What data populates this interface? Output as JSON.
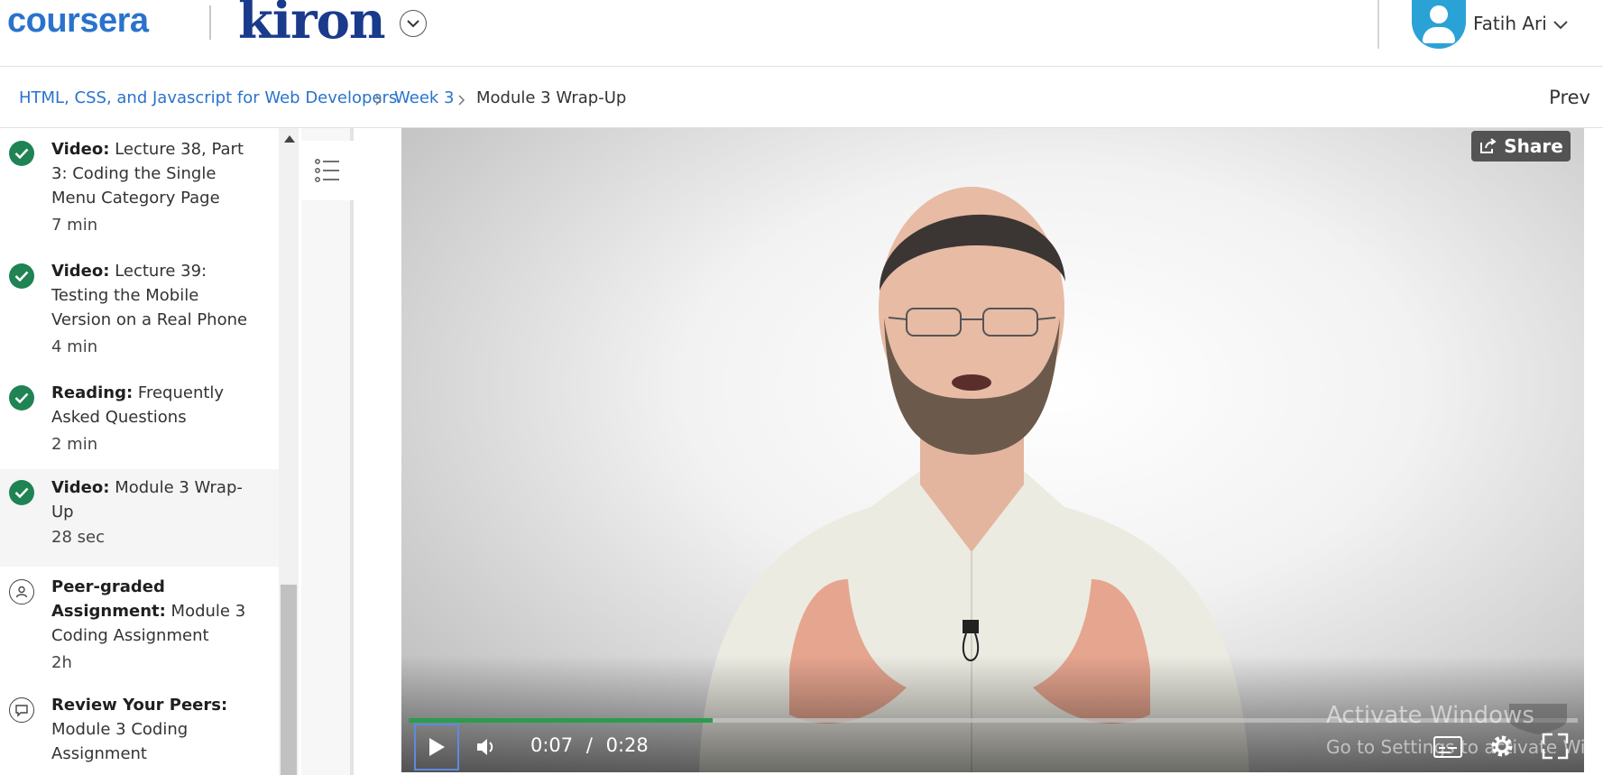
{
  "header": {
    "logo_text": "coursera",
    "partner_text": "kiron",
    "user_name": "Fatih Ari"
  },
  "breadcrumb": {
    "items": [
      "HTML, CSS, and Javascript for Web Developers",
      "Week 3",
      "Module 3 Wrap-Up"
    ],
    "prev_label": "Prev"
  },
  "sidebar": {
    "items": [
      {
        "type": "Video:",
        "title": "Lecture 38, Part 3: Coding the Single Menu Category Page",
        "duration": "7 min",
        "completed": true
      },
      {
        "type": "Video:",
        "title": "Lecture 39: Testing the Mobile Version on a Real Phone",
        "duration": "4 min",
        "completed": true
      },
      {
        "type": "Reading:",
        "title": "Frequently Asked Questions",
        "duration": "2 min",
        "completed": true
      },
      {
        "type": "Video:",
        "title": "Module 3 Wrap-Up",
        "duration": "28 sec",
        "completed": true,
        "active": true
      },
      {
        "type": "Peer-graded Assignment:",
        "title": "Module 3 Coding Assignment",
        "duration": "2h",
        "completed": false,
        "icon": "peer-graded-icon"
      },
      {
        "type": "Review Your Peers:",
        "title": "Module 3 Coding Assignment",
        "duration": "",
        "completed": false,
        "icon": "review-icon"
      }
    ]
  },
  "player": {
    "share_label": "Share",
    "current_time": "0:07",
    "separator": "/",
    "total_time": "0:28",
    "progress_fraction": 0.26
  },
  "overlay": {
    "line1": "Activate Windows",
    "line2": "Go to Settings to activate Windows."
  },
  "colors": {
    "accent": "#2a73cc",
    "complete": "#1f8354",
    "progress": "#2a9d4e",
    "avatar": "#2aa2d6"
  }
}
